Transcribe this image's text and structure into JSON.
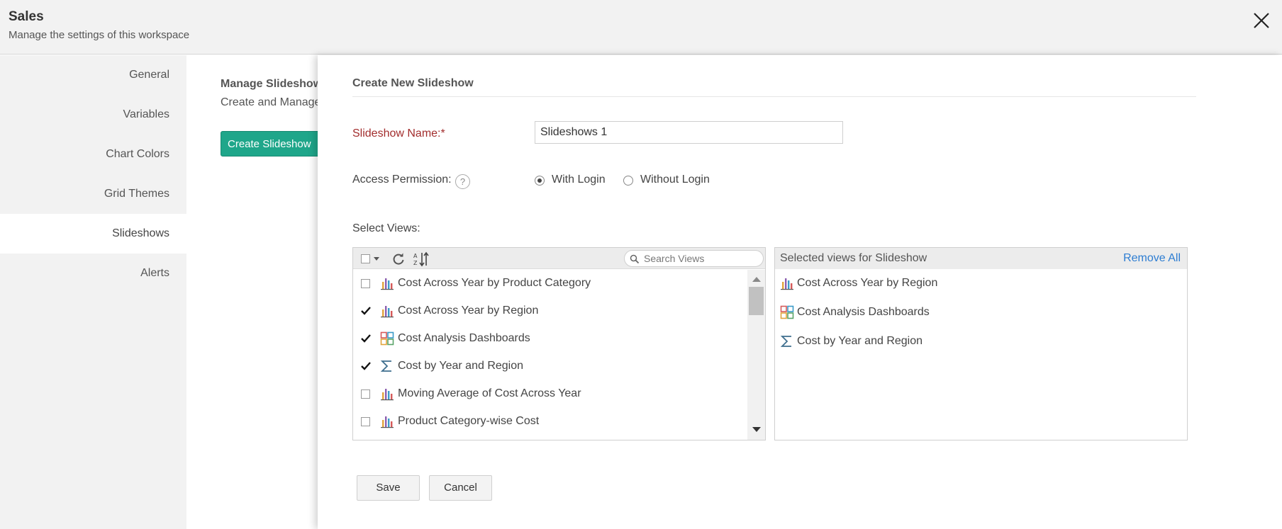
{
  "header": {
    "title": "Sales",
    "subtitle": "Manage the settings of this workspace"
  },
  "sidebar": {
    "items": [
      {
        "label": "General"
      },
      {
        "label": "Variables"
      },
      {
        "label": "Chart Colors"
      },
      {
        "label": "Grid Themes"
      },
      {
        "label": "Slideshows",
        "active": true
      },
      {
        "label": "Alerts"
      }
    ]
  },
  "background_page": {
    "heading": "Manage Slideshows",
    "description": "Create and Manage",
    "create_button": "Create Slideshow",
    "button_color": "#1fa68a"
  },
  "dialog": {
    "title": "Create New Slideshow",
    "name_label": "Slideshow Name:*",
    "name_value": "Slideshows 1",
    "access_label": "Access Permission:",
    "help_glyph": "?",
    "access_options": [
      {
        "label": "With Login",
        "selected": true
      },
      {
        "label": "Without Login",
        "selected": false
      }
    ],
    "select_views_label": "Select Views:",
    "search_placeholder": "Search Views",
    "views": [
      {
        "label": "Cost Across Year by Product Category",
        "checked": false,
        "icon": "bar-chart-icon"
      },
      {
        "label": "Cost Across Year by Region",
        "checked": true,
        "icon": "bar-chart-icon"
      },
      {
        "label": "Cost Analysis Dashboards",
        "checked": true,
        "icon": "dashboard-icon"
      },
      {
        "label": "Cost by Year and Region",
        "checked": true,
        "icon": "sigma-icon"
      },
      {
        "label": "Moving Average of Cost Across Year",
        "checked": false,
        "icon": "bar-chart-icon"
      },
      {
        "label": "Product Category-wise Cost",
        "checked": false,
        "icon": "bar-chart-icon"
      }
    ],
    "selected_header": "Selected views for Slideshow",
    "remove_all": "Remove All",
    "selected_views": [
      {
        "label": "Cost Across Year by Region",
        "icon": "bar-chart-icon"
      },
      {
        "label": "Cost Analysis Dashboards",
        "icon": "dashboard-icon"
      },
      {
        "label": "Cost by Year and Region",
        "icon": "sigma-icon"
      }
    ],
    "save_label": "Save",
    "cancel_label": "Cancel",
    "required_color": "#a22d2d",
    "link_color": "#2d7dd2"
  }
}
